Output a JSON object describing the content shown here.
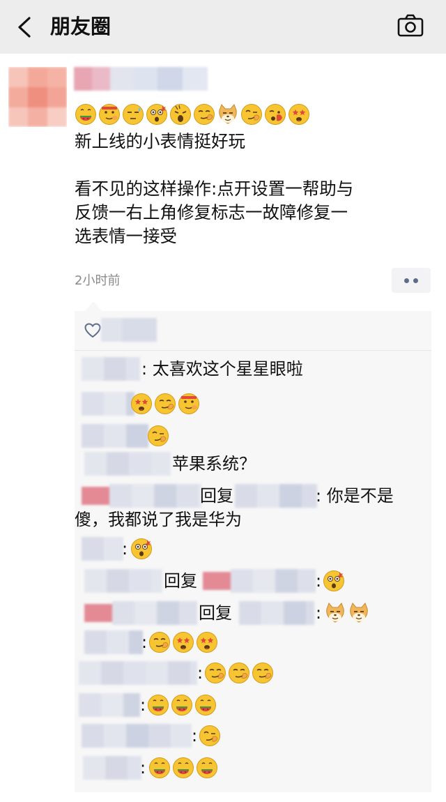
{
  "header": {
    "title": "朋友圈",
    "back_icon": "chevron-left-icon",
    "camera_icon": "camera-icon"
  },
  "post": {
    "text": "新上线的小表情挺好玩\n\n看不见的这样操作:点开设置一帮助与\n反馈一右上角修复标志一故障修复一\n选表情一接受",
    "time": "2小时前",
    "emojis": [
      "watermelon-face",
      "salute-face",
      "sweat-face",
      "wow-face",
      "cry-face",
      "smug-face",
      "doge-face",
      "smirk-face",
      "hand-face",
      "star-eyes-face"
    ]
  },
  "comments": [
    {
      "text": ": 太喜欢这个星星眼啦"
    },
    {
      "text": "",
      "emojis": [
        "star-eyes-face",
        "smug-face",
        "salute-face"
      ]
    },
    {
      "text": "",
      "emojis": [
        "smirk-face"
      ]
    },
    {
      "text": "苹果系统？"
    },
    {
      "reply_word": "回复",
      "text": ": 你是不是",
      "text2": "傻，我都说了我是华为"
    },
    {
      "text": ":",
      "emojis": [
        "wow-face"
      ]
    },
    {
      "reply_word": "回复",
      "text": ":",
      "emojis": [
        "wow-face"
      ]
    },
    {
      "reply_word": "回复",
      "text": ":",
      "emojis": [
        "doge-face",
        "doge-face"
      ]
    },
    {
      "text": ":",
      "emojis": [
        "smug-face",
        "star-eyes-face",
        "star-eyes-face"
      ]
    },
    {
      "text": ":",
      "emojis": [
        "smug-face",
        "smug-face",
        "smug-face"
      ]
    },
    {
      "text": ":",
      "emojis": [
        "watermelon-face",
        "watermelon-face",
        "watermelon-face"
      ]
    },
    {
      "text": ":",
      "emojis": [
        "smirk-face"
      ]
    },
    {
      "text": ":",
      "emojis": [
        "watermelon-face",
        "watermelon-face",
        "watermelon-face"
      ]
    }
  ],
  "colors": {
    "header_bg": "#ededed",
    "comment_bg": "#f7f7f7",
    "link_blue": "#5e6c8a",
    "emoji_yellow": "#f7c531"
  }
}
